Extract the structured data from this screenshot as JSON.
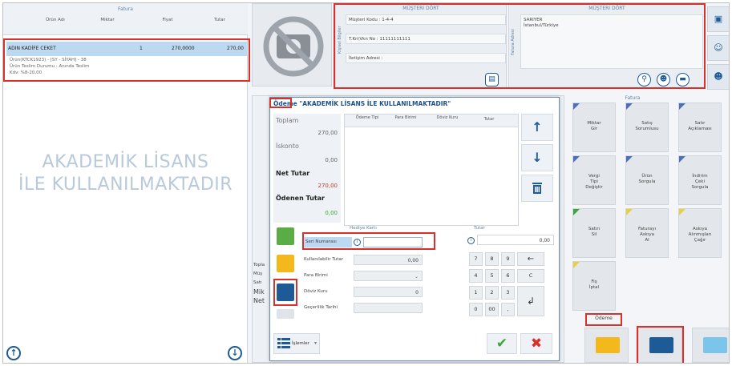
{
  "left_panel": {
    "grid_title": "Fatura",
    "columns": [
      "Ürün Adı",
      "Miktar",
      "Fiyat",
      "Tutar"
    ],
    "selected_row": {
      "name": "ADIN KADİFE CEKET",
      "qty": "1",
      "price": "270,0000",
      "total": "270,00"
    },
    "row_details": [
      "Ürün(KTCK1923) - [SY - SİYAH] - 38",
      "Ürün Teslim Durumu : Anında Teslim",
      "Kdv: %8-20,00"
    ],
    "watermark_line1": "AKADEMİK LİSANS",
    "watermark_line2": "İLE KULLANILMAKTADIR",
    "up_icon": "↑",
    "down_icon": "↓"
  },
  "customer_left": {
    "title": "MÜŞTERİ DÖRT",
    "side_label": "Kişisel Bilgiler",
    "code": "Müşteri Kodu : 1-4-4",
    "tax": "T.Kn\\Vkn No : 11111111111",
    "contact": "İletişim Adresi :"
  },
  "customer_right": {
    "title": "MÜŞTERİ DÖRT",
    "side_label": "Fatura Adresi",
    "line1": "SARIYER",
    "line2": "İstanbul/Türkiye"
  },
  "fatura_tiles": {
    "title": "Fatura",
    "tiles": [
      [
        "Miktar",
        "Gir"
      ],
      [
        "Satış",
        "Sorumlusu"
      ],
      [
        "Satır",
        "Açıklaması"
      ],
      [
        "Vergi",
        "Tipi",
        "Değiştir"
      ],
      [
        "Ürün",
        "Sorgula"
      ],
      [
        "İndirim",
        "Çeki",
        "Sorgula"
      ],
      [
        "Satırı",
        "Sil"
      ],
      [
        "Faturayı",
        "Askıya",
        "Al"
      ],
      [
        "Askıya",
        "Alınmışları",
        "Çağır"
      ],
      [
        "Fiş",
        "İptal"
      ]
    ]
  },
  "odeme_tab": "Ödeme",
  "dialog": {
    "title_prefix": "Ödeme",
    "title_rest": " \"AKADEMİK LİSANS İLE KULLANILMAKTADIR\"",
    "toplam_label": "Toplam",
    "toplam_value": "270,00",
    "iskonto_label": "İskonto",
    "iskonto_value": "0,00",
    "net_label": "Net Tutar",
    "net_value": "270,00",
    "paid_label": "Ödenen Tutar",
    "paid_value": "0,00",
    "grid_headers": [
      "Ödeme Tipi",
      "Para Birimi",
      "Döviz Kuru",
      "Tutar"
    ],
    "gift_header": "Hediye Kartı",
    "seri_label": "Seri Numarası",
    "kullanilabilir_label": "Kullanılabilir Tutar",
    "kullanilabilir_value": "0,00",
    "para_birimi_label": "Para Birimi",
    "doviz_label": "Döviz Kuru",
    "doviz_value": "0",
    "gecerlilik_label": "Geçerlilik Tarihi",
    "tutar_label": "Tutar",
    "tutar_value": "0,00",
    "keypad": [
      "7",
      "8",
      "9",
      "←",
      "4",
      "5",
      "6",
      "C",
      "1",
      "2",
      "3",
      "↲",
      "0",
      "00",
      ","
    ],
    "islemler_label": "İşlemler",
    "left_labels": [
      "Topla",
      "Müş",
      "Satı",
      "Mik",
      "Net"
    ]
  },
  "colors": {
    "accent_blue": "#1d5a96",
    "red_marker": "#d9302c",
    "green": "#3aa835"
  }
}
